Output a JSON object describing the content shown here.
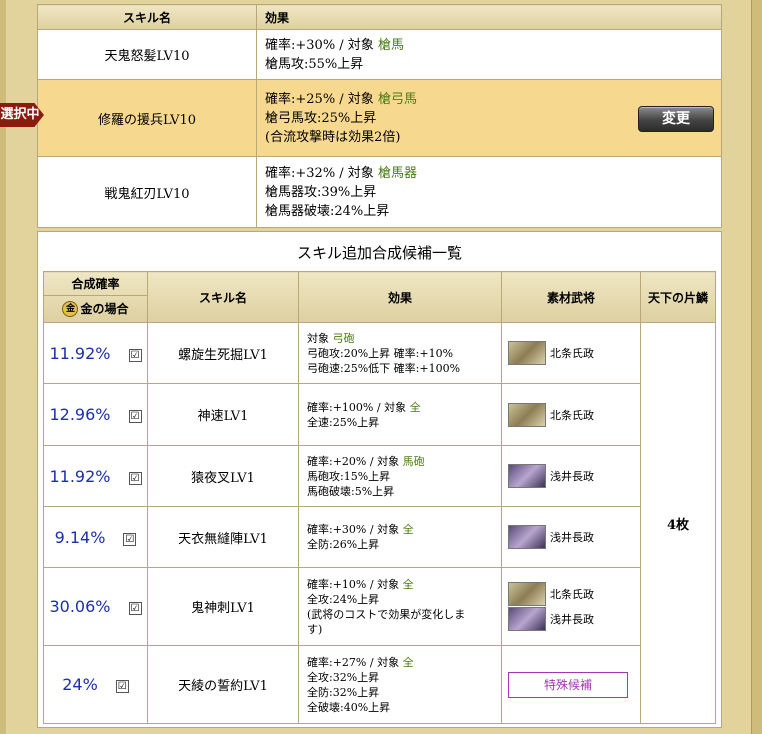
{
  "top": {
    "headers": [
      "スキル名",
      "効果"
    ],
    "selected_tag": "選択中",
    "change_button": "変更",
    "skills": [
      {
        "name": "天鬼怒髪LV10",
        "lines": [
          "確率:+30% / 対象 ",
          "槍馬攻:55%上昇"
        ],
        "target": "槍馬",
        "selected": false
      },
      {
        "name": "修羅の援兵LV10",
        "lines": [
          "確率:+25% / 対象 ",
          "槍弓馬攻:25%上昇",
          "(合流攻撃時は効果2倍)"
        ],
        "target": "槍弓馬",
        "selected": true
      },
      {
        "name": "戦鬼紅刃LV10",
        "lines": [
          "確率:+32% / 対象 ",
          "槍馬器攻:39%上昇",
          "槍馬器破壊:24%上昇"
        ],
        "target": "槍馬器",
        "selected": false
      }
    ]
  },
  "candidates": {
    "title": "スキル追加合成候補一覧",
    "headers": {
      "rate": "合成確率",
      "gold_case": "金の場合",
      "gold_icon": "金",
      "skill": "スキル名",
      "effect": "効果",
      "generals": "素材武将",
      "tenka": "天下の片鱗"
    },
    "tenka_value": "4枚",
    "special_label": "特殊候補",
    "rows": [
      {
        "rate": "11.92%",
        "skill": "螺旋生死掘LV1",
        "effect": [
          "対象 ",
          "弓砲攻:20%上昇 確率:+10%",
          "弓砲速:25%低下 確率:+100%"
        ],
        "target": "弓砲",
        "target_line": 0,
        "generals": [
          "北条氏政"
        ]
      },
      {
        "rate": "12.96%",
        "skill": "神速LV1",
        "effect": [
          "確率:+100% / 対象 ",
          "全速:25%上昇"
        ],
        "target": "全",
        "target_line": 0,
        "generals": [
          "北条氏政"
        ]
      },
      {
        "rate": "11.92%",
        "skill": "猿夜叉LV1",
        "effect": [
          "確率:+20% / 対象 ",
          "馬砲攻:15%上昇",
          "馬砲破壊:5%上昇"
        ],
        "target": "馬砲",
        "target_line": 0,
        "generals": [
          "浅井長政"
        ]
      },
      {
        "rate": "9.14%",
        "skill": "天衣無縫陣LV1",
        "effect": [
          "確率:+30% / 対象 ",
          "全防:26%上昇"
        ],
        "target": "全",
        "target_line": 0,
        "generals": [
          "浅井長政"
        ]
      },
      {
        "rate": "30.06%",
        "skill": "鬼神刺LV1",
        "effect": [
          "確率:+10% / 対象 ",
          "全攻:24%上昇",
          "(武将のコストで効果が変化しま",
          "す)"
        ],
        "target": "全",
        "target_line": 0,
        "generals": [
          "北条氏政",
          "浅井長政"
        ]
      },
      {
        "rate": "24%",
        "skill": "天綾の誓約LV1",
        "effect": [
          "確率:+27% / 対象 ",
          "全攻:32%上昇",
          "全防:32%上昇",
          "全破壊:40%上昇"
        ],
        "target": "全",
        "target_line": 0,
        "generals": [],
        "special": true
      }
    ]
  }
}
